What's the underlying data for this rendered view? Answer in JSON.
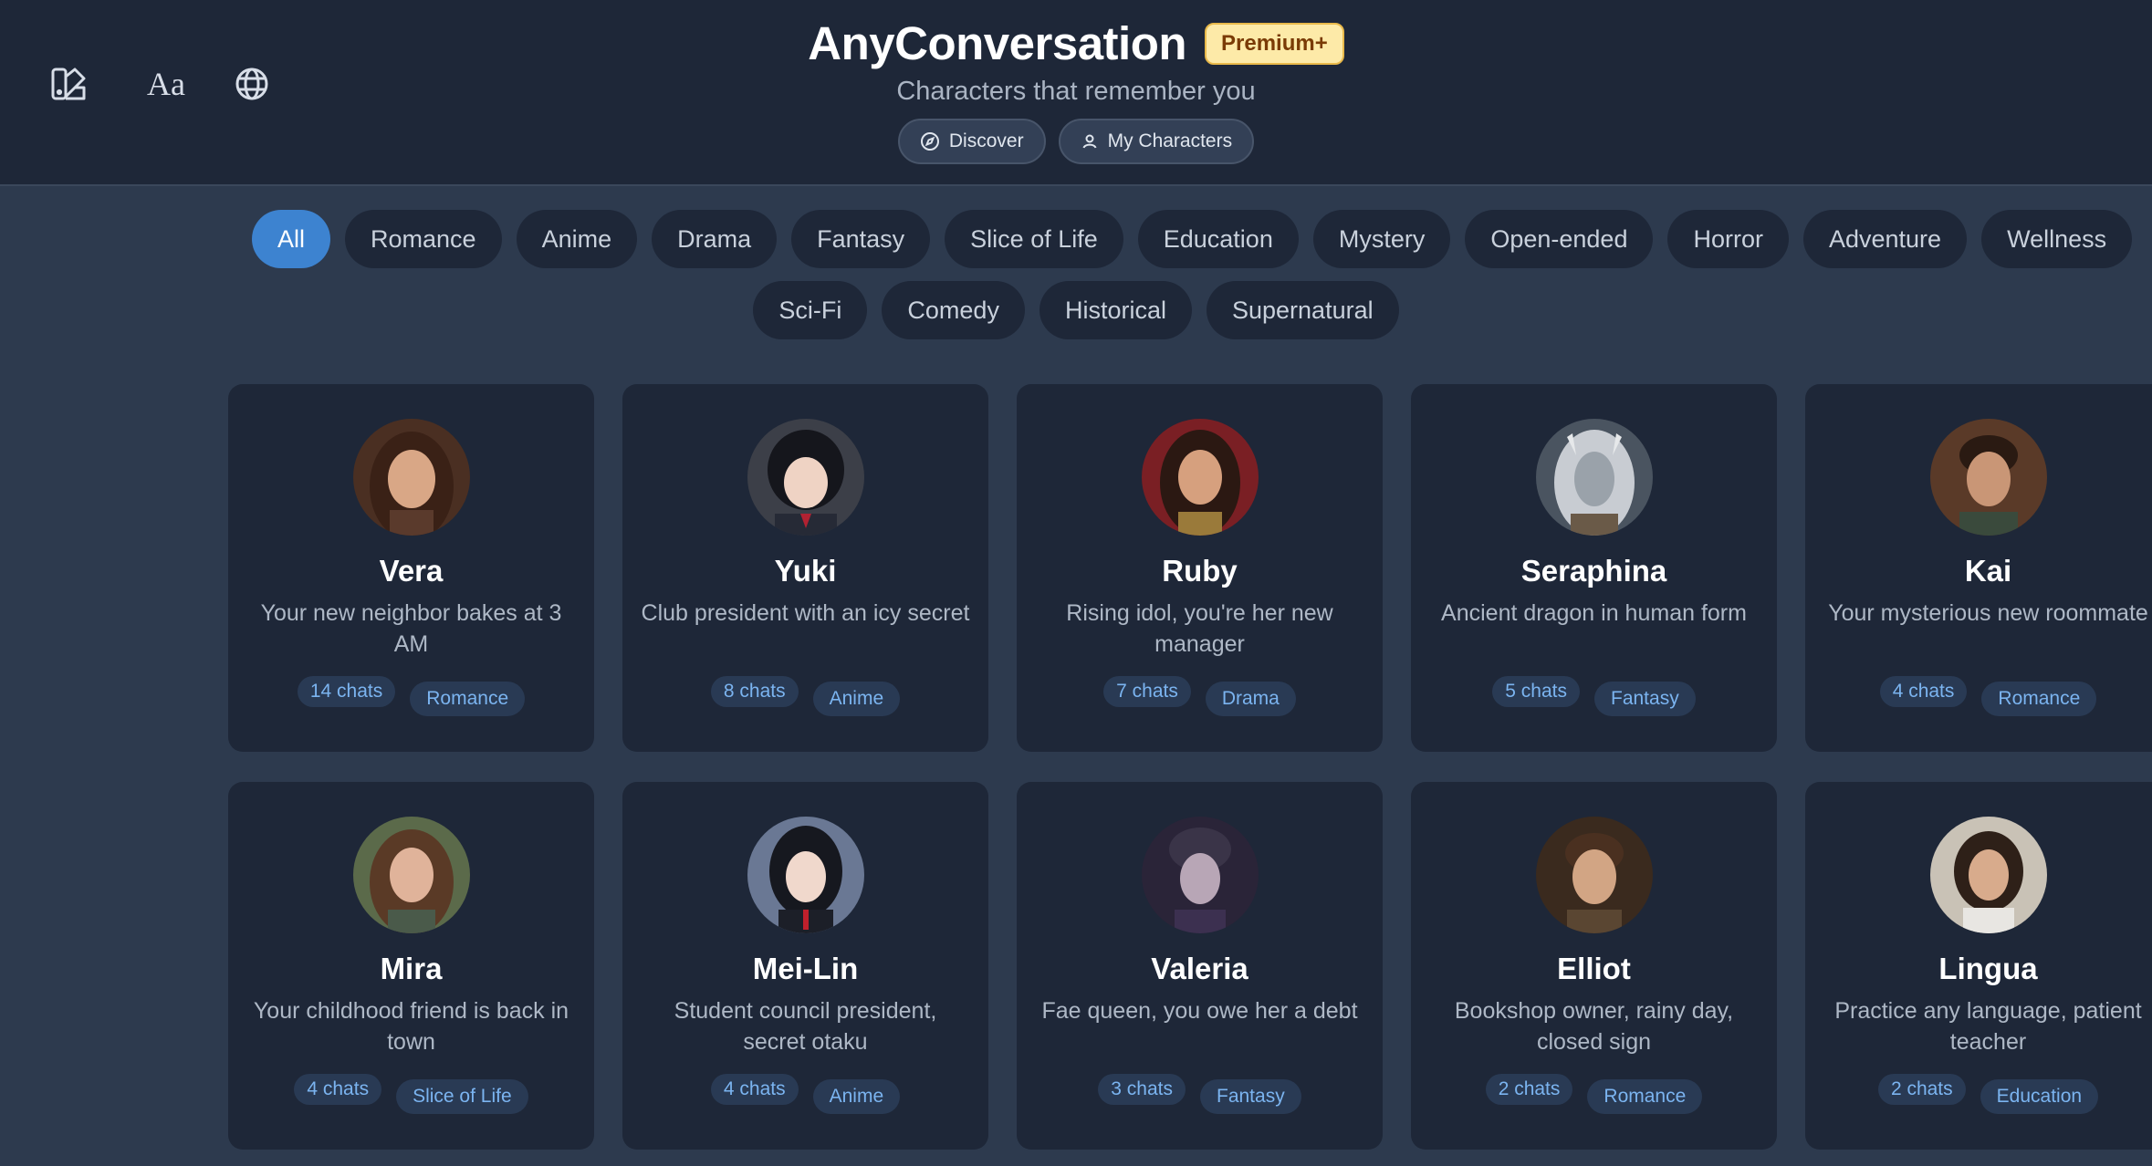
{
  "header": {
    "title": "AnyConversation",
    "badge": "Premium+",
    "subtitle": "Characters that remember you",
    "nav": [
      {
        "label": "Discover",
        "icon": "compass-icon"
      },
      {
        "label": "My Characters",
        "icon": "user-icon"
      }
    ],
    "tools": [
      {
        "icon": "theme-palette-icon"
      },
      {
        "icon": "font-size-icon",
        "glyph": "Aa"
      },
      {
        "icon": "globe-language-icon"
      }
    ]
  },
  "categories": {
    "row1": [
      "All",
      "Romance",
      "Anime",
      "Drama",
      "Fantasy",
      "Slice of Life",
      "Education",
      "Mystery",
      "Open-ended",
      "Horror",
      "Adventure",
      "Wellness"
    ],
    "row2": [
      "Sci-Fi",
      "Comedy",
      "Historical",
      "Supernatural"
    ],
    "selected": "All"
  },
  "characters": [
    {
      "name": "Vera",
      "description": "Your new neighbor bakes at 3 AM",
      "chats": "14 chats",
      "tag": "Romance"
    },
    {
      "name": "Yuki",
      "description": "Club president with an icy secret",
      "chats": "8 chats",
      "tag": "Anime"
    },
    {
      "name": "Ruby",
      "description": "Rising idol, you're her new manager",
      "chats": "7 chats",
      "tag": "Drama"
    },
    {
      "name": "Seraphina",
      "description": "Ancient dragon in human form",
      "chats": "5 chats",
      "tag": "Fantasy"
    },
    {
      "name": "Kai",
      "description": "Your mysterious new roommate",
      "chats": "4 chats",
      "tag": "Romance"
    },
    {
      "name": "Mira",
      "description": "Your childhood friend is back in town",
      "chats": "4 chats",
      "tag": "Slice of Life"
    },
    {
      "name": "Mei-Lin",
      "description": "Student council president, secret otaku",
      "chats": "4 chats",
      "tag": "Anime"
    },
    {
      "name": "Valeria",
      "description": "Fae queen, you owe her a debt",
      "chats": "3 chats",
      "tag": "Fantasy"
    },
    {
      "name": "Elliot",
      "description": "Bookshop owner, rainy day, closed sign",
      "chats": "2 chats",
      "tag": "Romance"
    },
    {
      "name": "Lingua",
      "description": "Practice any language, patient teacher",
      "chats": "2 chats",
      "tag": "Education"
    }
  ],
  "colors": {
    "background": "#2d3a4e",
    "header": "#1e2738",
    "card": "#1e2738",
    "accent": "#3d83d0",
    "badge_bg": "#fdeaa8",
    "tag_text": "#7bb4f0"
  }
}
